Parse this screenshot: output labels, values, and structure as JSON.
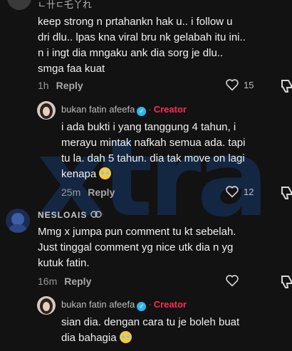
{
  "watermark": "xtra",
  "comments": [
    {
      "username": "ㄴ卄ㄷ乇丫れ",
      "text_lines": [
        "keep strong n prtahankn hak u.. i follow u",
        "dri dlu.. lpas kna viral bru nk gelabah itu ini..",
        "n i ingt dia mngaku ank dia sorg je dlu..",
        "smga faa kuat"
      ],
      "time": "1h",
      "reply_label": "Reply",
      "likes": "15"
    },
    {
      "username": "bukan fatin afeefa",
      "creator_badge": "Creator",
      "text_lines": [
        "i ada bukti i yang tanggung 4 tahun, i",
        "merayu mintak nafkah semua ada. tapi",
        "tu la. dah 5 tahun. dia tak move on lagi",
        "kenapa"
      ],
      "time": "25m",
      "reply_label": "Reply",
      "likes": "12"
    },
    {
      "username": "NESLOAIS",
      "text_lines": [
        "Mmg x jumpa pun comment tu kt sebelah.",
        "Just tinggal comment yg nice utk dia n yg",
        "kutuk fatin."
      ],
      "time": "16m",
      "reply_label": "Reply",
      "likes": ""
    },
    {
      "username": "bukan fatin afeefa",
      "creator_badge": "Creator",
      "text_lines": [
        "sian dia. dengan cara tu je boleh buat",
        "dia bahagia"
      ],
      "time": "",
      "reply_label": "",
      "likes": ""
    }
  ],
  "colors": {
    "background": "#121212",
    "creator": "#fe2c55",
    "verified": "#2fb8e6",
    "watermark": "#17396a"
  },
  "icons": [
    "heart-icon",
    "dislike-icon",
    "verified-icon",
    "crying-emoji-icon",
    "sparkle-icon"
  ]
}
